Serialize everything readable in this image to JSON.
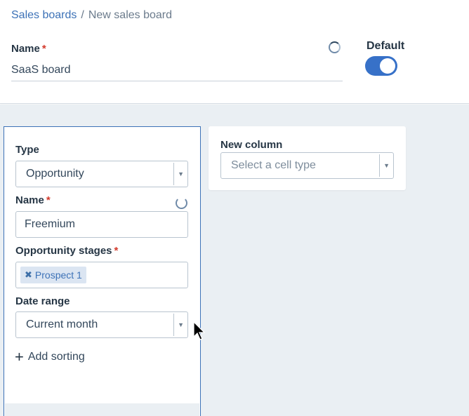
{
  "breadcrumb": {
    "parent": "Sales boards",
    "separator": "/",
    "current": "New sales board"
  },
  "board": {
    "name_label": "Name",
    "required_mark": "*",
    "name_value": "SaaS board",
    "default_label": "Default",
    "default_on": true
  },
  "column": {
    "type_label": "Type",
    "type_value": "Opportunity",
    "name_label": "Name",
    "required_mark": "*",
    "name_value": "Freemium",
    "stages_label": "Opportunity stages",
    "stages": [
      "Prospect 1"
    ],
    "date_range_label": "Date range",
    "date_range_value": "Current month",
    "add_sorting": "Add sorting"
  },
  "new_column": {
    "title": "New column",
    "cell_type_placeholder": "Select a cell type"
  },
  "icons": {
    "tag_remove": "close-icon",
    "dropdown": "caret-down-icon",
    "add": "plus-icon",
    "loading": "spinner-icon"
  },
  "colors": {
    "accent": "#3771c8",
    "link": "#3d72b7",
    "required": "#d33a2c",
    "canvas": "#eaeff3"
  }
}
